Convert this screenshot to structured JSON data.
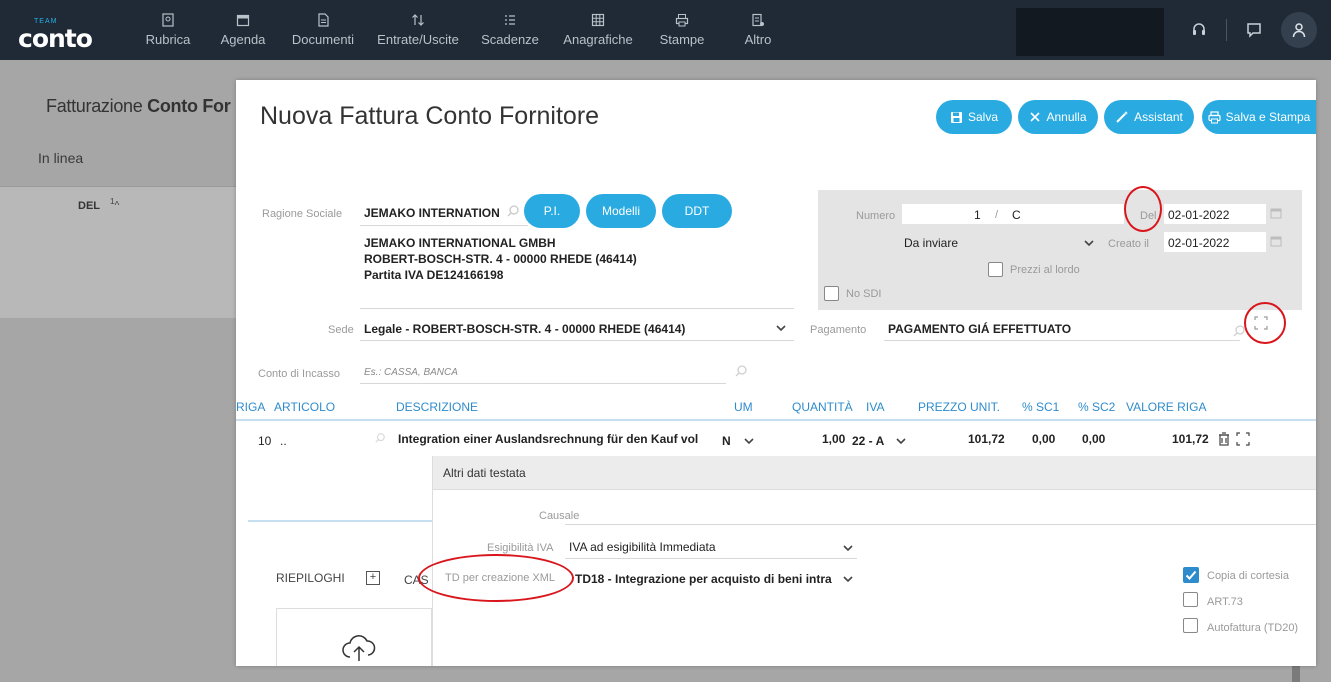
{
  "brand": {
    "small": "TEAM",
    "name": "conto"
  },
  "nav": [
    {
      "label": "Rubrica",
      "icon": "address-book-icon"
    },
    {
      "label": "Agenda",
      "icon": "calendar-icon"
    },
    {
      "label": "Documenti",
      "icon": "document-icon"
    },
    {
      "label": "Entrate/Uscite",
      "icon": "transfer-icon"
    },
    {
      "label": "Scadenze",
      "icon": "list-icon"
    },
    {
      "label": "Anagrafiche",
      "icon": "grid-icon"
    },
    {
      "label": "Stampe",
      "icon": "printer-icon"
    },
    {
      "label": "Altro",
      "icon": "more-icon"
    }
  ],
  "background": {
    "title_prefix": "Fatturazione ",
    "title_bold": "Conto For",
    "inline": "In linea",
    "col_header": "DEL",
    "col_sort": "1"
  },
  "modal": {
    "title": "Nuova Fattura Conto Fornitore",
    "buttons": {
      "save": "Salva",
      "cancel": "Annulla",
      "assistant": "Assistant",
      "save_print": "Salva e Stampa",
      "pi": "P.I.",
      "models": "Modelli",
      "ddt": "DDT"
    },
    "supplier": {
      "label": "Ragione Sociale",
      "value": "JEMAKO INTERNATION",
      "name": "JEMAKO INTERNATIONAL GMBH",
      "address": "ROBERT-BOSCH-STR. 4 - 00000 RHEDE (46414)",
      "vat": "Partita IVA DE124166198"
    },
    "document": {
      "number_label": "Numero",
      "number": "1",
      "series_sep": "/",
      "series": "C",
      "date_label": "Del",
      "date": "02-01-2022",
      "status": "Da inviare",
      "created_label": "Creato il",
      "created": "02-01-2022",
      "gross_prices": "Prezzi al lordo",
      "no_sdi": "No SDI"
    },
    "sede": {
      "label": "Sede",
      "value": "Legale - ROBERT-BOSCH-STR. 4 - 00000 RHEDE (46414)"
    },
    "payment": {
      "label": "Pagamento",
      "value": "PAGAMENTO GIÁ EFFETTUATO"
    },
    "income_account": {
      "label": "Conto di Incasso",
      "placeholder": "Es.: CASSA, BANCA"
    },
    "table": {
      "headers": [
        "RIGA",
        "ARTICOLO",
        "DESCRIZIONE",
        "UM",
        "QUANTITÀ",
        "IVA",
        "PREZZO UNIT.",
        "% SC1",
        "% SC2",
        "VALORE RIGA"
      ],
      "row": {
        "riga": "10",
        "articolo": "..",
        "descrizione": "Integration einer Auslandsrechnung für den Kauf vol",
        "um": "N",
        "quantita": "1,00",
        "iva": "22 - A",
        "prezzo": "101,72",
        "sc1": "0,00",
        "sc2": "0,00",
        "valore": "101,72"
      }
    },
    "panel": {
      "title": "Altri dati testata",
      "causale_label": "Causale",
      "esig_label": "Esigibilità IVA",
      "esig_value": "IVA ad esigibilità Immediata",
      "td_label": "TD per creazione XML",
      "td_value": "TD18 - Integrazione per acquisto di beni intra",
      "copia_cortesia": "Copia di cortesia",
      "art73": "ART.73",
      "autofattura": "Autofattura (TD20)"
    },
    "lower": {
      "riepiloghi": "RIEPILOGHI",
      "cas": "CAS"
    }
  },
  "colors": {
    "accent": "#29abe2",
    "topbar": "#1f2a36",
    "annotation": "#d9161c",
    "header_text": "#2f8ccc"
  }
}
